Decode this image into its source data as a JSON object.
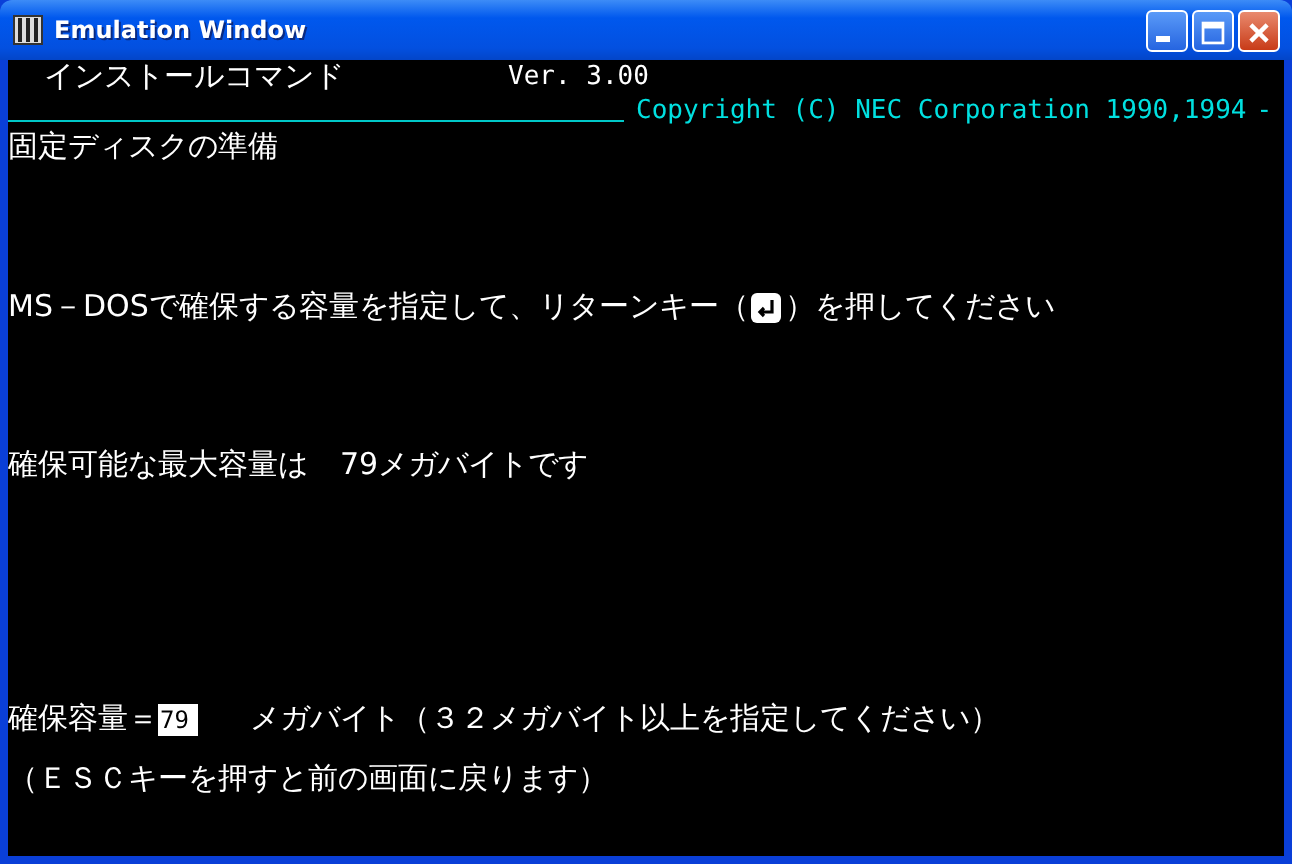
{
  "window": {
    "title": "Emulation Window"
  },
  "header": {
    "program": "インストールコマンド",
    "version": "Ver. 3.00",
    "copyright": "Copyright (C) NEC Corporation 1990,1994",
    "trail": "-"
  },
  "screen_title": "固定ディスクの準備",
  "instruction": {
    "before": "MS－DOSで確保する容量を指定して、リターンキー（",
    "after": "）を押してください"
  },
  "max_capacity": {
    "label": "確保可能な最大容量は",
    "value": "79メガバイトです"
  },
  "capacity_input": {
    "label": "確保容量＝",
    "value": "79",
    "unit": "メガバイト（３２メガバイト以上を指定してください）"
  },
  "esc_hint": "（ＥＳＣキーを押すと前の画面に戻ります）"
}
